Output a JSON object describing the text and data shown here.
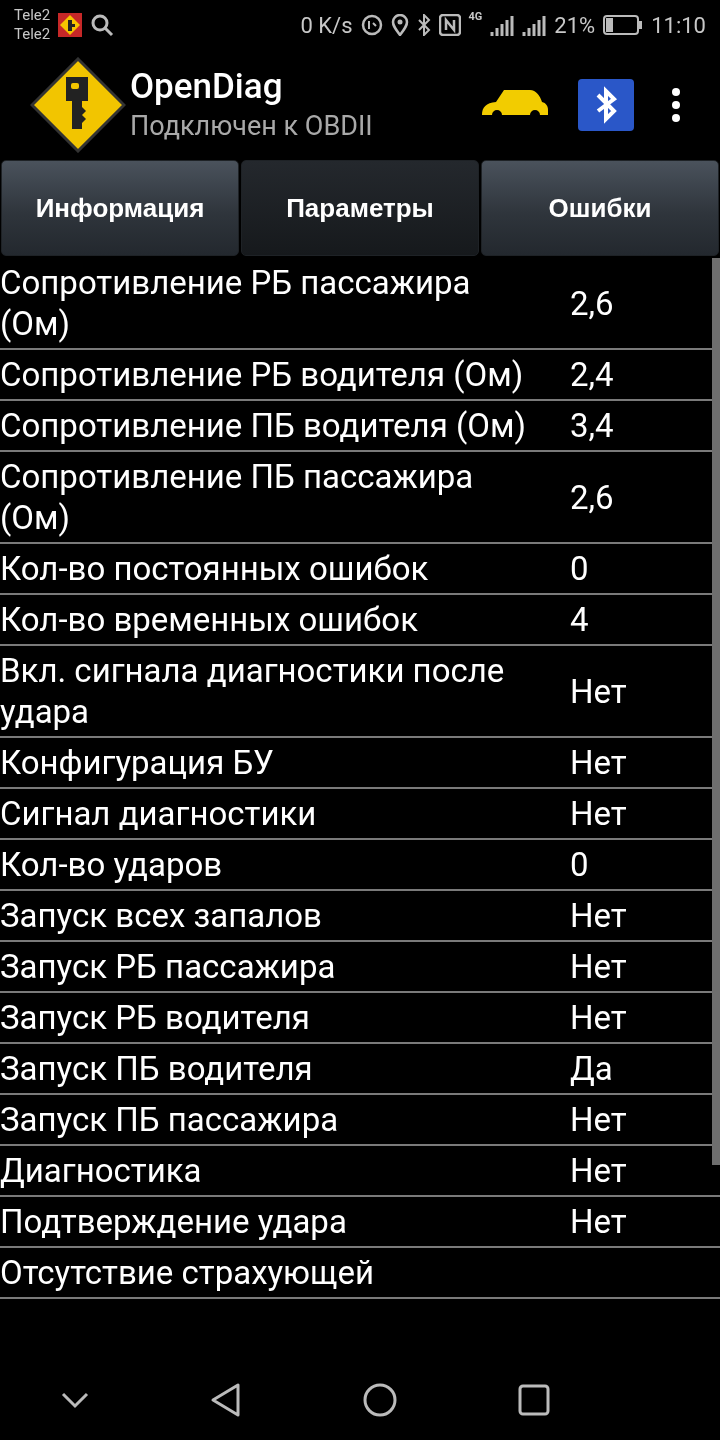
{
  "status_bar": {
    "carrier_1": "Tele2",
    "carrier_2": "Tele2",
    "speed": "0 K/s",
    "network": "4G",
    "battery": "21%",
    "time": "11:10"
  },
  "app_bar": {
    "title": "OpenDiag",
    "subtitle": "Подключен к OBDII"
  },
  "tabs": [
    {
      "label": "Информация",
      "selected": false
    },
    {
      "label": "Параметры",
      "selected": true
    },
    {
      "label": "Ошибки",
      "selected": false
    }
  ],
  "parameters": [
    {
      "name": "Сопротивление РБ пассажира (Ом)",
      "value": "2,6"
    },
    {
      "name": "Сопротивление РБ водителя (Ом)",
      "value": "2,4"
    },
    {
      "name": "Сопротивление ПБ водителя (Ом)",
      "value": "3,4"
    },
    {
      "name": "Сопротивление ПБ пассажира (Ом)",
      "value": "2,6"
    },
    {
      "name": "Кол-во постоянных ошибок",
      "value": "0"
    },
    {
      "name": "Кол-во временных ошибок",
      "value": "4"
    },
    {
      "name": "Вкл. сигнала диагностики после удара",
      "value": "Нет"
    },
    {
      "name": "Конфигурация БУ",
      "value": "Нет"
    },
    {
      "name": "Сигнал диагностики",
      "value": "Нет"
    },
    {
      "name": "Кол-во ударов",
      "value": "0"
    },
    {
      "name": "Запуск всех запалов",
      "value": "Нет"
    },
    {
      "name": "Запуск РБ пассажира",
      "value": "Нет"
    },
    {
      "name": "Запуск РБ водителя",
      "value": "Нет"
    },
    {
      "name": "Запуск ПБ водителя",
      "value": "Да"
    },
    {
      "name": "Запуск ПБ пассажира",
      "value": "Нет"
    },
    {
      "name": "Диагностика",
      "value": "Нет"
    },
    {
      "name": "Подтверждение удара",
      "value": "Нет"
    },
    {
      "name": "Отсутствие страхующей"
    }
  ]
}
